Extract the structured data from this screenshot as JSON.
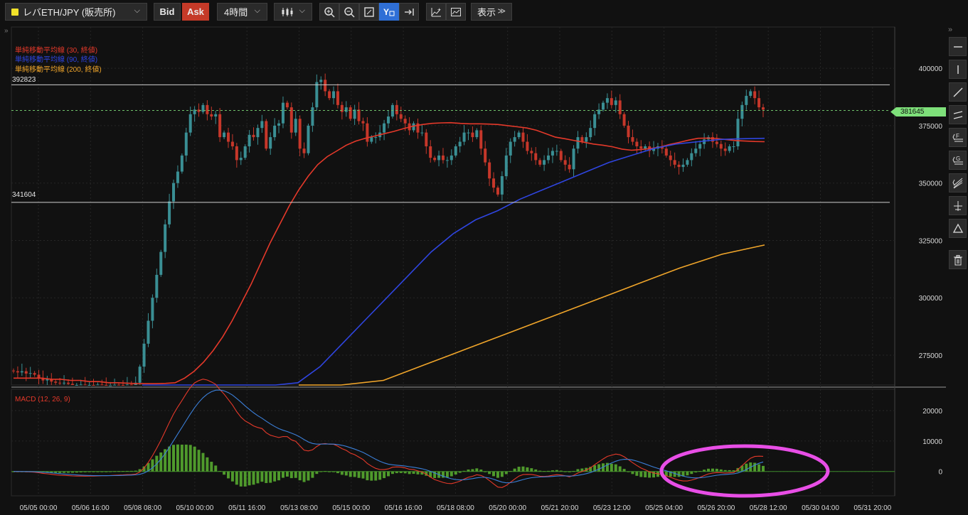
{
  "toolbar": {
    "symbol": "レバETH/JPY (販売所)",
    "bid_label": "Bid",
    "ask_label": "Ask",
    "timeframe": "4時間",
    "view_label": "表示",
    "symbol_color": "#f2e22a",
    "ask_color": "#c53a28",
    "tools": [
      "zoom-in-icon",
      "zoom-out-icon",
      "fit-icon",
      "auto-scale-icon",
      "scroll-end-icon",
      "add-indicator-icon",
      "compare-icon"
    ]
  },
  "legend": {
    "sma30": "単純移動平均線 (30, 終値)",
    "sma90": "単純移動平均線 (90, 終値)",
    "sma200": "単純移動平均線 (200, 終値)",
    "macd": "MACD (12, 26, 9)"
  },
  "lines": {
    "upper_label": "392823",
    "lower_label": "341604",
    "current_price": "381645"
  },
  "right_tools": [
    "horizontal-line-icon",
    "vertical-line-icon",
    "trend-line-icon",
    "parallel-line-icon",
    "fibonacci-icon",
    "gann-icon",
    "pitchfork-icon",
    "measure-icon",
    "triangle-icon",
    "trash-icon"
  ],
  "chart_data": [
    {
      "type": "candlestick",
      "title": "",
      "y_ticks": [
        "400000",
        "375000",
        "350000",
        "325000",
        "300000",
        "275000"
      ],
      "x_ticks": [
        "05/05 00:00",
        "05/06 16:00",
        "05/08 08:00",
        "05/10 00:00",
        "05/11 16:00",
        "05/13 08:00",
        "05/15 00:00",
        "05/16 16:00",
        "05/18 08:00",
        "05/20 00:00",
        "05/21 20:00",
        "05/23 12:00",
        "05/25 04:00",
        "05/26 20:00",
        "05/28 12:00",
        "05/30 04:00",
        "05/31 20:00"
      ],
      "ylim": [
        262000,
        418000
      ],
      "closes": [
        268000,
        267500,
        268000,
        267000,
        267200,
        266500,
        265000,
        264000,
        264500,
        263500,
        263000,
        262800,
        263000,
        262500,
        262000,
        262000,
        262200,
        261800,
        262000,
        261800,
        262200,
        262000,
        261500,
        261800,
        262100,
        262000,
        261800,
        262200,
        262000,
        263000,
        270000,
        280000,
        290000,
        300000,
        310000,
        320000,
        332000,
        342000,
        350000,
        355000,
        362000,
        372000,
        380000,
        382000,
        381000,
        384000,
        380000,
        379000,
        380000,
        370000,
        372000,
        368000,
        366000,
        360000,
        361000,
        366000,
        371000,
        370000,
        374000,
        377000,
        365000,
        370000,
        375000,
        376000,
        385000,
        383000,
        372000,
        378000,
        365000,
        363000,
        375000,
        383000,
        394000,
        395000,
        390000,
        387000,
        390000,
        384000,
        381000,
        383000,
        378000,
        382000,
        377000,
        376000,
        368000,
        370000,
        370000,
        372000,
        376000,
        379000,
        384000,
        380000,
        378000,
        376000,
        373000,
        376000,
        372000,
        372000,
        366000,
        361000,
        360000,
        362000,
        360000,
        360000,
        362000,
        366000,
        368000,
        372000,
        372000,
        370000,
        373000,
        365000,
        359000,
        352000,
        348000,
        345000,
        353000,
        362000,
        368000,
        370000,
        372000,
        368000,
        364000,
        363000,
        360000,
        358000,
        360000,
        362000,
        364000,
        364000,
        360000,
        358000,
        356000,
        365000,
        370000,
        368000,
        370000,
        374000,
        380000,
        382000,
        385000,
        387000,
        384000,
        386000,
        380000,
        375000,
        370000,
        368000,
        366000,
        365000,
        366000,
        364000,
        365000,
        366000,
        365000,
        362000,
        360000,
        358000,
        357000,
        358000,
        360000,
        363000,
        365000,
        367000,
        369000,
        370000,
        368000,
        367000,
        365000,
        364000,
        366000,
        366000,
        378000,
        384000,
        388000,
        390000,
        387000,
        383000,
        382000
      ],
      "sma30": [
        265000,
        265000,
        265000,
        265000,
        264500,
        264500,
        264000,
        264000,
        263500,
        263500,
        263000,
        263000,
        262800,
        262600,
        262600,
        262600,
        262700,
        263000,
        265000,
        268000,
        272000,
        277000,
        283000,
        290000,
        298000,
        306000,
        315000,
        324000,
        332000,
        340000,
        347000,
        353000,
        358000,
        361500,
        364000,
        366500,
        368300,
        369500,
        370500,
        371500,
        372500,
        373700,
        374800,
        375500,
        376000,
        376200,
        376300,
        376000,
        375800,
        375800,
        375700,
        375500,
        375000,
        374500,
        374000,
        373000,
        371500,
        370000,
        369300,
        368500,
        367800,
        367000,
        366500,
        365800,
        364800,
        364300,
        364600,
        365000,
        365700,
        366800,
        367700,
        368700,
        369500,
        369600,
        369400,
        368900,
        368500,
        368300,
        368100,
        368000
      ],
      "sma90": [
        261000,
        260000,
        259000,
        259000,
        258000,
        258000,
        259000,
        263000,
        270000,
        280000,
        290000,
        300000,
        310000,
        320000,
        328000,
        334000,
        338000,
        343000,
        347000,
        351000,
        355000,
        359000,
        362000,
        365000,
        367000,
        368000,
        369000,
        369300,
        369500
      ],
      "sma200": [
        255000,
        258000,
        264000,
        271000,
        278000,
        285000,
        292000,
        299000,
        306000,
        313000,
        319000,
        323000
      ]
    },
    {
      "type": "macd",
      "y_ticks": [
        "20000",
        "10000",
        "0"
      ],
      "ylim": [
        -8000,
        27000
      ],
      "note_ellipse": true
    }
  ]
}
